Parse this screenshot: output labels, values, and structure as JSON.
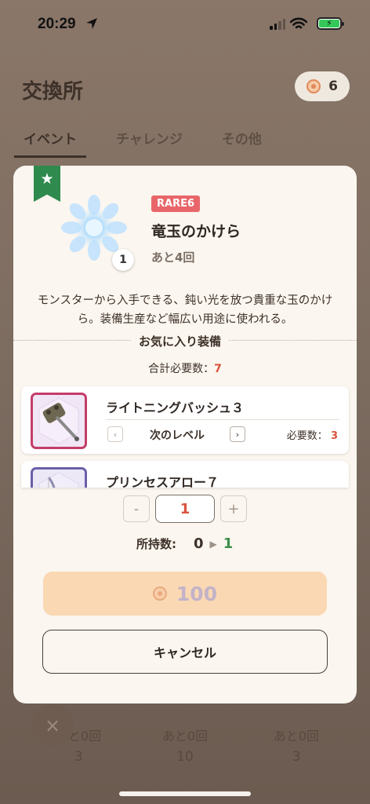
{
  "status_bar": {
    "time": "20:29"
  },
  "header": {
    "title": "交換所",
    "currency_count": "6"
  },
  "tabs": [
    {
      "label": "イベント",
      "active": true
    },
    {
      "label": "チャレンジ",
      "active": false
    },
    {
      "label": "その他",
      "active": false
    }
  ],
  "background_items": [
    {
      "remaining": "あと0回",
      "cost": "3"
    },
    {
      "remaining": "あと0回",
      "cost": "10"
    },
    {
      "remaining": "あと0回",
      "cost": "3"
    }
  ],
  "modal": {
    "rarity": "RARE6",
    "item_name": "竜玉のかけら",
    "item_quantity": "1",
    "remaining": "あと4回",
    "description": "モンスターから入手できる、鈍い光を放つ貴重な玉のかけら。装備生産など幅広い用途に使われる。",
    "favorites_title": "お気に入り装備",
    "total_required_label": "合計必要数：",
    "total_required_value": "7",
    "equipment": [
      {
        "name": "ライトニングバッシュ３",
        "next_level_label": "次のレベル",
        "required_label": "必要数：",
        "required_value": "3"
      },
      {
        "name": "プリンセスアロー７"
      }
    ],
    "stepper": {
      "minus": "-",
      "value": "1",
      "plus": "+"
    },
    "owned": {
      "label": "所持数:",
      "from": "0",
      "to": "1"
    },
    "buy_button": {
      "price": "100"
    },
    "cancel_button": {
      "label": "キャンセル"
    }
  },
  "colors": {
    "accent_red": "#d9533e",
    "ribbon_green": "#2f8a4d",
    "buy_bg": "#fad8b3"
  }
}
